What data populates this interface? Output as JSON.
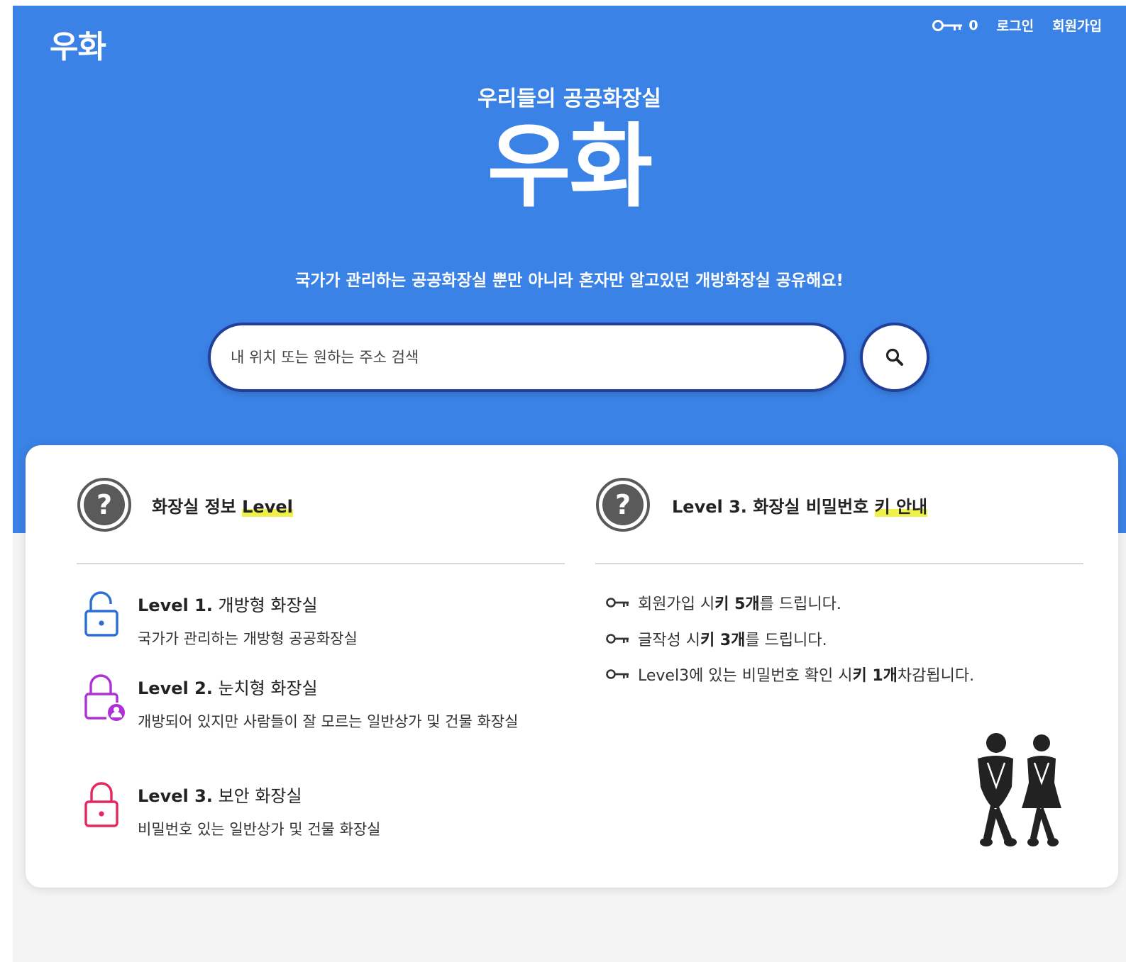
{
  "header": {
    "logo": "우화",
    "key_count": "0",
    "login": "로그인",
    "signup": "회원가입"
  },
  "hero": {
    "tagline": "우리들의 공공화장실",
    "title": "우화",
    "subtitle": "국가가 관리하는 공공화장실 뿐만 아니라 혼자만 알고있던 개방화장실 공유해요!",
    "search_placeholder": "내 위치 또는 원하는 주소 검색"
  },
  "levels": {
    "heading_prefix": "화장실 정보 ",
    "heading_highlight": "Level",
    "items": [
      {
        "level": "Level 1.",
        "name": " 개방형 화장실",
        "desc": "국가가 관리하는 개방형 공공화장실",
        "color": "#2b6fd6"
      },
      {
        "level": "Level 2.",
        "name": " 눈치형 화장실",
        "desc": "개방되어 있지만 사람들이 잘 모르는 일반상가 및 건물 화장실",
        "color": "#b030d8"
      },
      {
        "level": "Level 3.",
        "name": " 보안 화장실",
        "desc": "비밀번호 있는 일반상가 및 건물 화장실",
        "color": "#e8265e"
      }
    ]
  },
  "keys": {
    "heading_prefix": "Level 3. 화장실 비밀번호 ",
    "heading_highlight": "키 안내",
    "rules": [
      {
        "pre": "회원가입 시 ",
        "bold": "키 5개",
        "post": "를 드립니다."
      },
      {
        "pre": "글작성 시 ",
        "bold": "키 3개",
        "post": "를 드립니다."
      },
      {
        "pre": "Level3에 있는 비밀번호 확인 시 ",
        "bold": "키 1개",
        "post": " 차감됩니다."
      }
    ]
  },
  "colors": {
    "hero_bg": "#3b82e6",
    "search_border": "#1f3f9b",
    "highlight": "#f0f04a"
  }
}
